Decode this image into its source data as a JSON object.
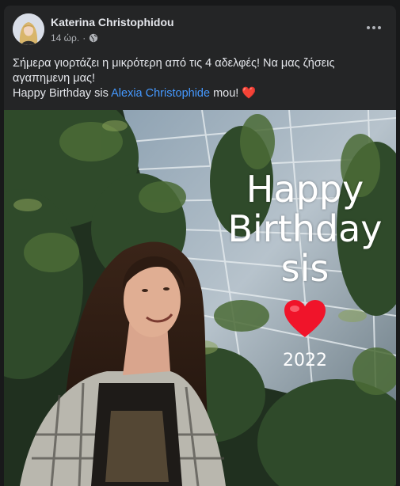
{
  "post": {
    "author": "Katerina Christophidou",
    "time": "14 ώρ.",
    "dot": "·",
    "privacy_icon": "globe-icon",
    "menu_icon": "more-options-icon",
    "text_line1": "Σήμερα γιορτάζει η μικρότερη από τις 4 αδελφές! Να μας ζήσεις αγαπημενη μας!",
    "text_line2_before": "Happy Birthday sis ",
    "mention": "Alexia Christophide",
    "text_line2_after": " mou! ",
    "emoji": "❤️"
  },
  "photo": {
    "overlay_line1": "Happy",
    "overlay_line2": "Birthday",
    "overlay_line3": "sis",
    "overlay_year": "2022",
    "heart_icon": "red-heart-icon"
  },
  "colors": {
    "background": "#18191a",
    "card": "#242526",
    "mention": "#4599ff",
    "heart": "#f02849"
  }
}
